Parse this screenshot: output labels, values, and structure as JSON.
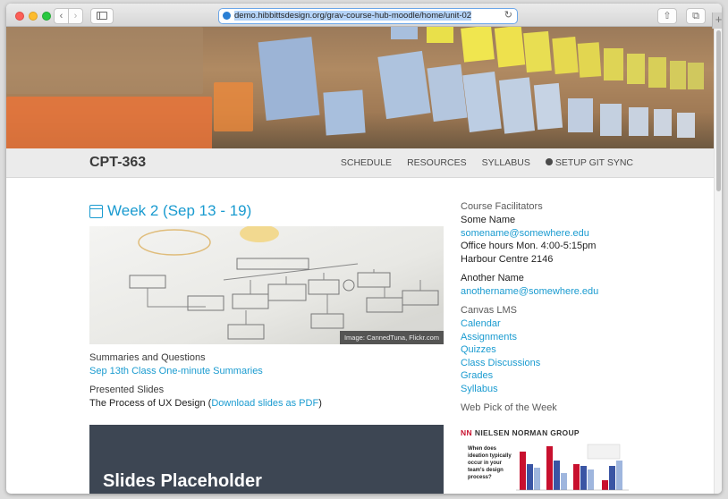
{
  "browser": {
    "url": "demo.hibbittsdesign.org/grav-course-hub-moodle/home/unit-02",
    "back_glyph": "‹",
    "forward_glyph": "›",
    "reload_glyph": "↻",
    "share_glyph": "⇧",
    "tabs_glyph": "⧉",
    "newtab_glyph": "+"
  },
  "header": {
    "course_title": "CPT-363",
    "nav": [
      "SCHEDULE",
      "RESOURCES",
      "SYLLABUS",
      "SETUP GIT SYNC"
    ]
  },
  "main": {
    "week_title": "Week 2 (Sep 13 - 19)",
    "image_credit": "Image: CannedTuna, Flickr.com",
    "summaries_label": "Summaries and Questions",
    "summaries_link": "Sep 13th Class One-minute Summaries",
    "slides_label": "Presented Slides",
    "slides_text": "The Process of UX Design (",
    "slides_link": "Download slides as PDF",
    "slides_close": ")",
    "placeholder": "Slides Placeholder"
  },
  "sidebar": {
    "facilitators_heading": "Course Facilitators",
    "person1_name": "Some Name",
    "person1_email": "somename@somewhere.edu",
    "person1_hours": "Office hours Mon. 4:00-5:15pm",
    "person1_location": "Harbour Centre 2146",
    "person2_name": "Another Name",
    "person2_email": "anothername@somewhere.edu",
    "lms_heading": "Canvas LMS",
    "lms_links": [
      "Calendar",
      "Assignments",
      "Quizzes",
      "Class Discussions",
      "Grades",
      "Syllabus"
    ],
    "pick_heading": "Web Pick of the Week",
    "nn_logo": "NN",
    "nn_brand": "NIELSEN NORMAN GROUP",
    "nn_question": "When does ideation typically occur in your team's design process?"
  },
  "colors": {
    "link": "#1a9bd0",
    "topbar_bg": "#ebebeb",
    "slides_bg": "#3d4653",
    "nn_red": "#c8102e"
  }
}
